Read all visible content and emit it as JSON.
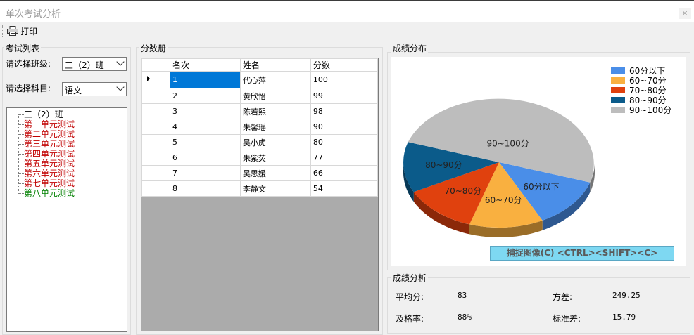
{
  "window": {
    "title": "单次考试分析",
    "close_glyph": "×"
  },
  "toolbar": {
    "print_label": "打印"
  },
  "exam_list": {
    "legend": "考试列表",
    "class_label": "请选择班级:",
    "class_value": "三（2）班",
    "subject_label": "请选择科目:",
    "subject_value": "语文",
    "tree_root": "三（2）班",
    "tree_items": [
      {
        "label": "第一单元测试",
        "color": "#c00000"
      },
      {
        "label": "第二单元测试",
        "color": "#c00000"
      },
      {
        "label": "第三单元测试",
        "color": "#c00000"
      },
      {
        "label": "第四单元测试",
        "color": "#c00000"
      },
      {
        "label": "第五单元测试",
        "color": "#c00000"
      },
      {
        "label": "第六单元测试",
        "color": "#c00000"
      },
      {
        "label": "第七单元测试",
        "color": "#c00000"
      },
      {
        "label": "第八单元测试",
        "color": "#008000"
      }
    ]
  },
  "grade_book": {
    "legend": "分数册",
    "columns": [
      "名次",
      "姓名",
      "分数"
    ],
    "rows": [
      [
        "1",
        "代心萍",
        "100"
      ],
      [
        "2",
        "黄欣怡",
        "99"
      ],
      [
        "3",
        "陈若熙",
        "98"
      ],
      [
        "4",
        "朱馨瑶",
        "90"
      ],
      [
        "5",
        "吴小虎",
        "80"
      ],
      [
        "6",
        "朱紫荧",
        "77"
      ],
      [
        "7",
        "吴思媛",
        "66"
      ],
      [
        "8",
        "李静文",
        "54"
      ]
    ],
    "selected_row": 0
  },
  "distribution": {
    "legend": "成绩分布",
    "capture_label": "捕捉图像(C)    <CTRL><SHIFT><C>"
  },
  "chart_data": {
    "type": "pie",
    "title": "",
    "slices": [
      {
        "label": "60分以下",
        "value": 1,
        "color": "#4a8ee8"
      },
      {
        "label": "60~70分",
        "value": 1,
        "color": "#f9b040"
      },
      {
        "label": "70~80分",
        "value": 1,
        "color": "#e0410e"
      },
      {
        "label": "80~90分",
        "value": 1,
        "color": "#0b5b8a"
      },
      {
        "label": "90~100分",
        "value": 4,
        "color": "#bdbdbd"
      }
    ],
    "legend_position": "top-right"
  },
  "analysis": {
    "legend": "成绩分析",
    "average_label": "平均分:",
    "average_value": "83",
    "variance_label": "方差:",
    "variance_value": "249.25",
    "pass_rate_label": "及格率:",
    "pass_rate_value": "88%",
    "std_label": "标准差:",
    "std_value": "15.79"
  }
}
